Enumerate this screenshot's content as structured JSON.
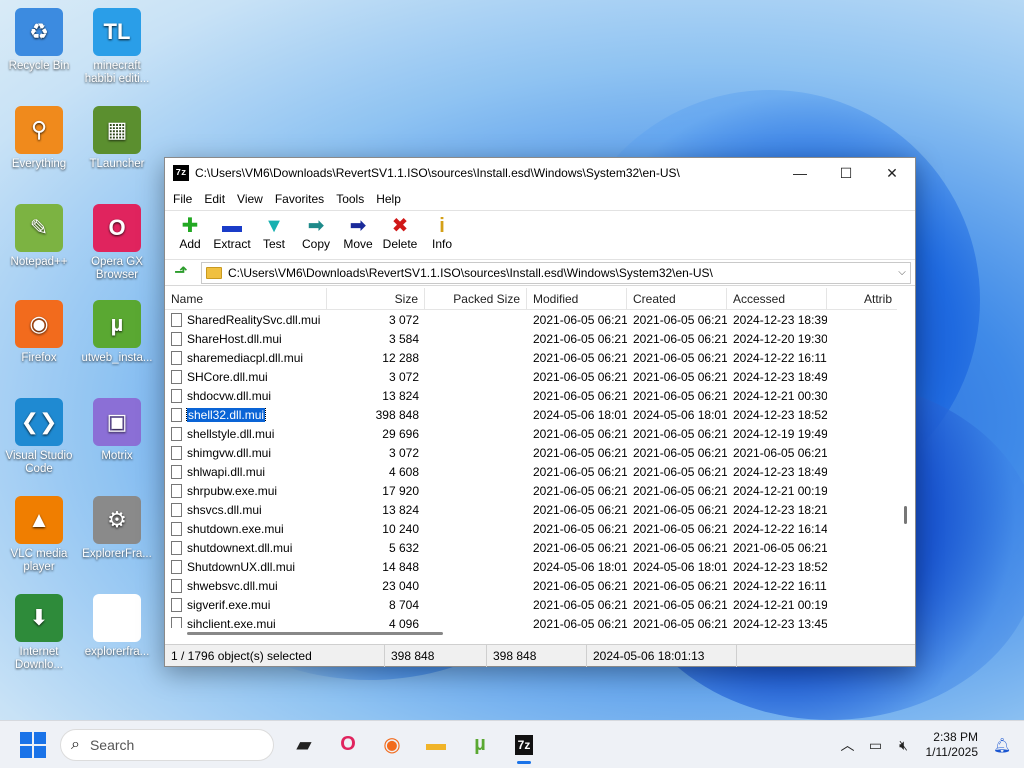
{
  "desktop": {
    "icons": [
      {
        "label": "Recycle Bin",
        "glyph": "♻",
        "color": "#3c8be0"
      },
      {
        "label": "minecraft habibi editi...",
        "glyph": "TL",
        "color": "#2a9ee8"
      },
      {
        "label": "Everything",
        "glyph": "⚲",
        "color": "#f08a1c"
      },
      {
        "label": "TLauncher",
        "glyph": "▦",
        "color": "#5b8f2f"
      },
      {
        "label": "Notepad++",
        "glyph": "✎",
        "color": "#7cb342"
      },
      {
        "label": "Opera GX Browser",
        "glyph": "O",
        "color": "#e0245e"
      },
      {
        "label": "Firefox",
        "glyph": "◉",
        "color": "#f26b1d"
      },
      {
        "label": "utweb_insta...",
        "glyph": "µ",
        "color": "#5aa832"
      },
      {
        "label": "Visual Studio Code",
        "glyph": "❮❯",
        "color": "#1f8ad2"
      },
      {
        "label": "Motrix",
        "glyph": "▣",
        "color": "#8b6fd6"
      },
      {
        "label": "VLC media player",
        "glyph": "▲",
        "color": "#f07e00"
      },
      {
        "label": "ExplorerFra...",
        "glyph": "⚙",
        "color": "#8a8a8a"
      },
      {
        "label": "Internet Downlo...",
        "glyph": "⬇",
        "color": "#2e8b3a"
      },
      {
        "label": "explorerfra...",
        "glyph": "",
        "color": "#ffffff"
      }
    ]
  },
  "window": {
    "title": "C:\\Users\\VM6\\Downloads\\RevertSV1.1.ISO\\sources\\Install.esd\\Windows\\System32\\en-US\\",
    "app_icon": "7z",
    "menu": [
      "File",
      "Edit",
      "View",
      "Favorites",
      "Tools",
      "Help"
    ],
    "toolbar": [
      {
        "label": "Add",
        "glyph": "✚",
        "color": "#22a822"
      },
      {
        "label": "Extract",
        "glyph": "▬",
        "color": "#1a3cc8"
      },
      {
        "label": "Test",
        "glyph": "▼",
        "color": "#17b0b0"
      },
      {
        "label": "Copy",
        "glyph": "➡",
        "color": "#1e8a8a"
      },
      {
        "label": "Move",
        "glyph": "➡",
        "color": "#1a2a9a"
      },
      {
        "label": "Delete",
        "glyph": "✖",
        "color": "#d01818"
      },
      {
        "label": "Info",
        "glyph": "i",
        "color": "#d4a017"
      }
    ],
    "address": "C:\\Users\\VM6\\Downloads\\RevertSV1.1.ISO\\sources\\Install.esd\\Windows\\System32\\en-US\\",
    "columns": [
      "Name",
      "Size",
      "Packed Size",
      "Modified",
      "Created",
      "Accessed",
      "Attrib"
    ],
    "rows": [
      {
        "name": "SharedRealitySvc.dll.mui",
        "size": "3 072",
        "packed": "",
        "modified": "2021-06-05 06:21",
        "created": "2021-06-05 06:21",
        "accessed": "2024-12-23 18:39"
      },
      {
        "name": "ShareHost.dll.mui",
        "size": "3 584",
        "packed": "",
        "modified": "2021-06-05 06:21",
        "created": "2021-06-05 06:21",
        "accessed": "2024-12-20 19:30"
      },
      {
        "name": "sharemediacpl.dll.mui",
        "size": "12 288",
        "packed": "",
        "modified": "2021-06-05 06:21",
        "created": "2021-06-05 06:21",
        "accessed": "2024-12-22 16:11"
      },
      {
        "name": "SHCore.dll.mui",
        "size": "3 072",
        "packed": "",
        "modified": "2021-06-05 06:21",
        "created": "2021-06-05 06:21",
        "accessed": "2024-12-23 18:49"
      },
      {
        "name": "shdocvw.dll.mui",
        "size": "13 824",
        "packed": "",
        "modified": "2021-06-05 06:21",
        "created": "2021-06-05 06:21",
        "accessed": "2024-12-21 00:30"
      },
      {
        "name": "shell32.dll.mui",
        "size": "398 848",
        "packed": "",
        "modified": "2024-05-06 18:01",
        "created": "2024-05-06 18:01",
        "accessed": "2024-12-23 18:52",
        "selected": true
      },
      {
        "name": "shellstyle.dll.mui",
        "size": "29 696",
        "packed": "",
        "modified": "2021-06-05 06:21",
        "created": "2021-06-05 06:21",
        "accessed": "2024-12-19 19:49"
      },
      {
        "name": "shimgvw.dll.mui",
        "size": "3 072",
        "packed": "",
        "modified": "2021-06-05 06:21",
        "created": "2021-06-05 06:21",
        "accessed": "2021-06-05 06:21"
      },
      {
        "name": "shlwapi.dll.mui",
        "size": "4 608",
        "packed": "",
        "modified": "2021-06-05 06:21",
        "created": "2021-06-05 06:21",
        "accessed": "2024-12-23 18:49"
      },
      {
        "name": "shrpubw.exe.mui",
        "size": "17 920",
        "packed": "",
        "modified": "2021-06-05 06:21",
        "created": "2021-06-05 06:21",
        "accessed": "2024-12-21 00:19"
      },
      {
        "name": "shsvcs.dll.mui",
        "size": "13 824",
        "packed": "",
        "modified": "2021-06-05 06:21",
        "created": "2021-06-05 06:21",
        "accessed": "2024-12-23 18:21"
      },
      {
        "name": "shutdown.exe.mui",
        "size": "10 240",
        "packed": "",
        "modified": "2021-06-05 06:21",
        "created": "2021-06-05 06:21",
        "accessed": "2024-12-22 16:14"
      },
      {
        "name": "shutdownext.dll.mui",
        "size": "5 632",
        "packed": "",
        "modified": "2021-06-05 06:21",
        "created": "2021-06-05 06:21",
        "accessed": "2021-06-05 06:21"
      },
      {
        "name": "ShutdownUX.dll.mui",
        "size": "14 848",
        "packed": "",
        "modified": "2024-05-06 18:01",
        "created": "2024-05-06 18:01",
        "accessed": "2024-12-23 18:52"
      },
      {
        "name": "shwebsvc.dll.mui",
        "size": "23 040",
        "packed": "",
        "modified": "2021-06-05 06:21",
        "created": "2021-06-05 06:21",
        "accessed": "2024-12-22 16:11"
      },
      {
        "name": "sigverif.exe.mui",
        "size": "8 704",
        "packed": "",
        "modified": "2021-06-05 06:21",
        "created": "2021-06-05 06:21",
        "accessed": "2024-12-21 00:19"
      },
      {
        "name": "sihclient.exe.mui",
        "size": "4 096",
        "packed": "",
        "modified": "2021-06-05 06:21",
        "created": "2021-06-05 06:21",
        "accessed": "2024-12-23 13:45"
      }
    ],
    "status": {
      "selection": "1 / 1796 object(s) selected",
      "size": "398 848",
      "packed": "398 848",
      "modified": "2024-05-06 18:01:13"
    }
  },
  "taskbar": {
    "search_placeholder": "Search",
    "apps": [
      {
        "name": "task-view",
        "glyph": "▰",
        "color": "#222222"
      },
      {
        "name": "opera-gx",
        "glyph": "O",
        "color": "#e0245e"
      },
      {
        "name": "firefox",
        "glyph": "◉",
        "color": "#f26b1d"
      },
      {
        "name": "file-explorer",
        "glyph": "▬",
        "color": "#f0b429"
      },
      {
        "name": "utorrent-web",
        "glyph": "µ",
        "color": "#5aa832"
      },
      {
        "name": "7zip",
        "glyph": "7z",
        "color": "#111111",
        "active": true
      }
    ],
    "time": "2:38 PM",
    "date": "1/11/2025"
  }
}
